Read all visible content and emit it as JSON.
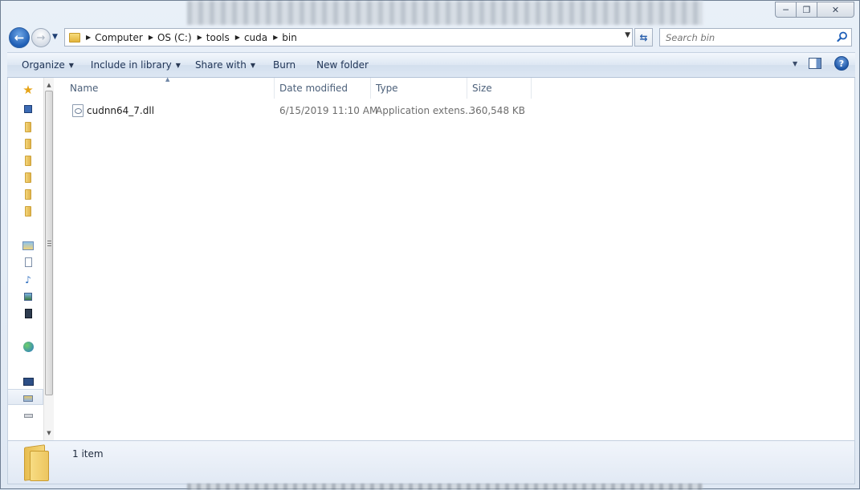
{
  "window": {
    "caption": {
      "minimize": "─",
      "maximize": "❐",
      "close": "✕"
    }
  },
  "nav": {
    "back_glyph": "←",
    "forward_glyph": "→",
    "breadcrumbs": [
      "Computer",
      "OS (C:)",
      "tools",
      "cuda",
      "bin"
    ],
    "refresh_glyph": "⇆",
    "search_placeholder": "Search bin"
  },
  "toolbar": {
    "organize": "Organize",
    "include_in_library": "Include in library",
    "share_with": "Share with",
    "burn": "Burn",
    "new_folder": "New folder",
    "help": "?"
  },
  "columns": {
    "name": "Name",
    "date_modified": "Date modified",
    "type": "Type",
    "size": "Size"
  },
  "files": [
    {
      "name": "cudnn64_7.dll",
      "date_modified": "6/15/2019 11:10 AM",
      "type": "Application extens...",
      "size": "360,548 KB"
    }
  ],
  "details": {
    "item_count": "1 item"
  },
  "nav_pane": {
    "icons": [
      "favorites-star-icon",
      "desktop-icon",
      "folder-icon",
      "folder-icon",
      "folder-icon",
      "folder-icon",
      "folder-icon",
      "folder-icon",
      "libraries-icon",
      "documents-icon",
      "music-icon",
      "pictures-icon",
      "videos-icon",
      "homegroup-icon",
      "computer-icon",
      "drive-icon",
      "removable-drive-icon"
    ]
  },
  "colors": {
    "accent": "#1f5eb5",
    "toolbar_text": "#1e3355",
    "header_text": "#4c607a",
    "muted_text": "#6d6d6d"
  }
}
